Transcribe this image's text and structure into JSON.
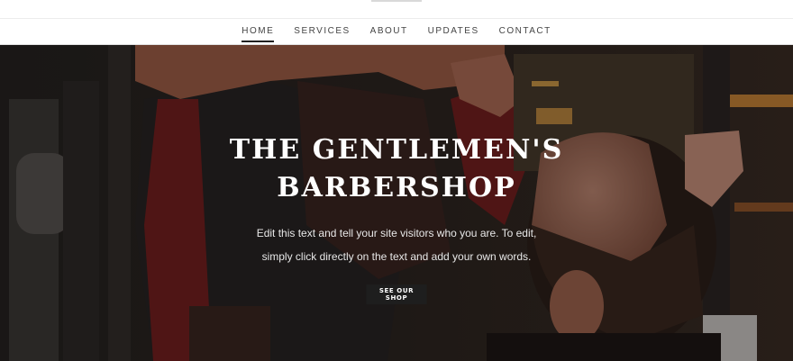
{
  "nav": {
    "items": [
      {
        "label": "HOME",
        "active": true
      },
      {
        "label": "SERVICES",
        "active": false
      },
      {
        "label": "ABOUT",
        "active": false
      },
      {
        "label": "UPDATES",
        "active": false
      },
      {
        "label": "CONTACT",
        "active": false
      }
    ]
  },
  "hero": {
    "title": "THE GENTLEMEN'S\nBARBERSHOP",
    "text_line1": "Edit this text and tell your site visitors who you are. To edit,",
    "text_line2": "simply click directly on the text and add your own words.",
    "button_label": "SEE OUR SHOP",
    "background_image": "barber-trimming-beard-photo"
  },
  "colors": {
    "nav_text": "#444444",
    "nav_active_underline": "#222222",
    "button_bg": "#1e1e1e",
    "hero_text": "#ffffff"
  }
}
